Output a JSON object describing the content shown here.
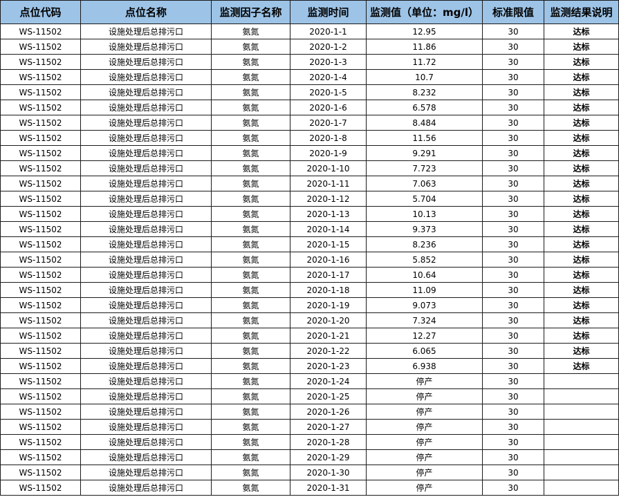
{
  "columns": [
    "点位代码",
    "点位名称",
    "监测因子名称",
    "监测时间",
    "监测值（单位：mg/l）",
    "标准限值",
    "监测结果说明"
  ],
  "rows": [
    {
      "code": "WS-11502",
      "name": "设施处理后总排污口",
      "factor": "氨氮",
      "date": "2020-1-1",
      "value": "12.95",
      "limit": "30",
      "result": "达标"
    },
    {
      "code": "WS-11502",
      "name": "设施处理后总排污口",
      "factor": "氨氮",
      "date": "2020-1-2",
      "value": "11.86",
      "limit": "30",
      "result": "达标"
    },
    {
      "code": "WS-11502",
      "name": "设施处理后总排污口",
      "factor": "氨氮",
      "date": "2020-1-3",
      "value": "11.72",
      "limit": "30",
      "result": "达标"
    },
    {
      "code": "WS-11502",
      "name": "设施处理后总排污口",
      "factor": "氨氮",
      "date": "2020-1-4",
      "value": "10.7",
      "limit": "30",
      "result": "达标"
    },
    {
      "code": "WS-11502",
      "name": "设施处理后总排污口",
      "factor": "氨氮",
      "date": "2020-1-5",
      "value": "8.232",
      "limit": "30",
      "result": "达标"
    },
    {
      "code": "WS-11502",
      "name": "设施处理后总排污口",
      "factor": "氨氮",
      "date": "2020-1-6",
      "value": "6.578",
      "limit": "30",
      "result": "达标"
    },
    {
      "code": "WS-11502",
      "name": "设施处理后总排污口",
      "factor": "氨氮",
      "date": "2020-1-7",
      "value": "8.484",
      "limit": "30",
      "result": "达标"
    },
    {
      "code": "WS-11502",
      "name": "设施处理后总排污口",
      "factor": "氨氮",
      "date": "2020-1-8",
      "value": "11.56",
      "limit": "30",
      "result": "达标"
    },
    {
      "code": "WS-11502",
      "name": "设施处理后总排污口",
      "factor": "氨氮",
      "date": "2020-1-9",
      "value": "9.291",
      "limit": "30",
      "result": "达标"
    },
    {
      "code": "WS-11502",
      "name": "设施处理后总排污口",
      "factor": "氨氮",
      "date": "2020-1-10",
      "value": "7.723",
      "limit": "30",
      "result": "达标"
    },
    {
      "code": "WS-11502",
      "name": "设施处理后总排污口",
      "factor": "氨氮",
      "date": "2020-1-11",
      "value": "7.063",
      "limit": "30",
      "result": "达标"
    },
    {
      "code": "WS-11502",
      "name": "设施处理后总排污口",
      "factor": "氨氮",
      "date": "2020-1-12",
      "value": "5.704",
      "limit": "30",
      "result": "达标"
    },
    {
      "code": "WS-11502",
      "name": "设施处理后总排污口",
      "factor": "氨氮",
      "date": "2020-1-13",
      "value": "10.13",
      "limit": "30",
      "result": "达标"
    },
    {
      "code": "WS-11502",
      "name": "设施处理后总排污口",
      "factor": "氨氮",
      "date": "2020-1-14",
      "value": "9.373",
      "limit": "30",
      "result": "达标"
    },
    {
      "code": "WS-11502",
      "name": "设施处理后总排污口",
      "factor": "氨氮",
      "date": "2020-1-15",
      "value": "8.236",
      "limit": "30",
      "result": "达标"
    },
    {
      "code": "WS-11502",
      "name": "设施处理后总排污口",
      "factor": "氨氮",
      "date": "2020-1-16",
      "value": "5.852",
      "limit": "30",
      "result": "达标"
    },
    {
      "code": "WS-11502",
      "name": "设施处理后总排污口",
      "factor": "氨氮",
      "date": "2020-1-17",
      "value": "10.64",
      "limit": "30",
      "result": "达标"
    },
    {
      "code": "WS-11502",
      "name": "设施处理后总排污口",
      "factor": "氨氮",
      "date": "2020-1-18",
      "value": "11.09",
      "limit": "30",
      "result": "达标"
    },
    {
      "code": "WS-11502",
      "name": "设施处理后总排污口",
      "factor": "氨氮",
      "date": "2020-1-19",
      "value": "9.073",
      "limit": "30",
      "result": "达标"
    },
    {
      "code": "WS-11502",
      "name": "设施处理后总排污口",
      "factor": "氨氮",
      "date": "2020-1-20",
      "value": "7.324",
      "limit": "30",
      "result": "达标"
    },
    {
      "code": "WS-11502",
      "name": "设施处理后总排污口",
      "factor": "氨氮",
      "date": "2020-1-21",
      "value": "12.27",
      "limit": "30",
      "result": "达标"
    },
    {
      "code": "WS-11502",
      "name": "设施处理后总排污口",
      "factor": "氨氮",
      "date": "2020-1-22",
      "value": "6.065",
      "limit": "30",
      "result": "达标"
    },
    {
      "code": "WS-11502",
      "name": "设施处理后总排污口",
      "factor": "氨氮",
      "date": "2020-1-23",
      "value": "6.938",
      "limit": "30",
      "result": "达标"
    },
    {
      "code": "WS-11502",
      "name": "设施处理后总排污口",
      "factor": "氨氮",
      "date": "2020-1-24",
      "value": "停产",
      "limit": "30",
      "result": ""
    },
    {
      "code": "WS-11502",
      "name": "设施处理后总排污口",
      "factor": "氨氮",
      "date": "2020-1-25",
      "value": "停产",
      "limit": "30",
      "result": ""
    },
    {
      "code": "WS-11502",
      "name": "设施处理后总排污口",
      "factor": "氨氮",
      "date": "2020-1-26",
      "value": "停产",
      "limit": "30",
      "result": ""
    },
    {
      "code": "WS-11502",
      "name": "设施处理后总排污口",
      "factor": "氨氮",
      "date": "2020-1-27",
      "value": "停产",
      "limit": "30",
      "result": ""
    },
    {
      "code": "WS-11502",
      "name": "设施处理后总排污口",
      "factor": "氨氮",
      "date": "2020-1-28",
      "value": "停产",
      "limit": "30",
      "result": ""
    },
    {
      "code": "WS-11502",
      "name": "设施处理后总排污口",
      "factor": "氨氮",
      "date": "2020-1-29",
      "value": "停产",
      "limit": "30",
      "result": ""
    },
    {
      "code": "WS-11502",
      "name": "设施处理后总排污口",
      "factor": "氨氮",
      "date": "2020-1-30",
      "value": "停产",
      "limit": "30",
      "result": ""
    },
    {
      "code": "WS-11502",
      "name": "设施处理后总排污口",
      "factor": "氨氮",
      "date": "2020-1-31",
      "value": "停产",
      "limit": "30",
      "result": ""
    }
  ],
  "colors": {
    "header_bg": "#9dc3e6",
    "border": "#1a1a1a"
  }
}
